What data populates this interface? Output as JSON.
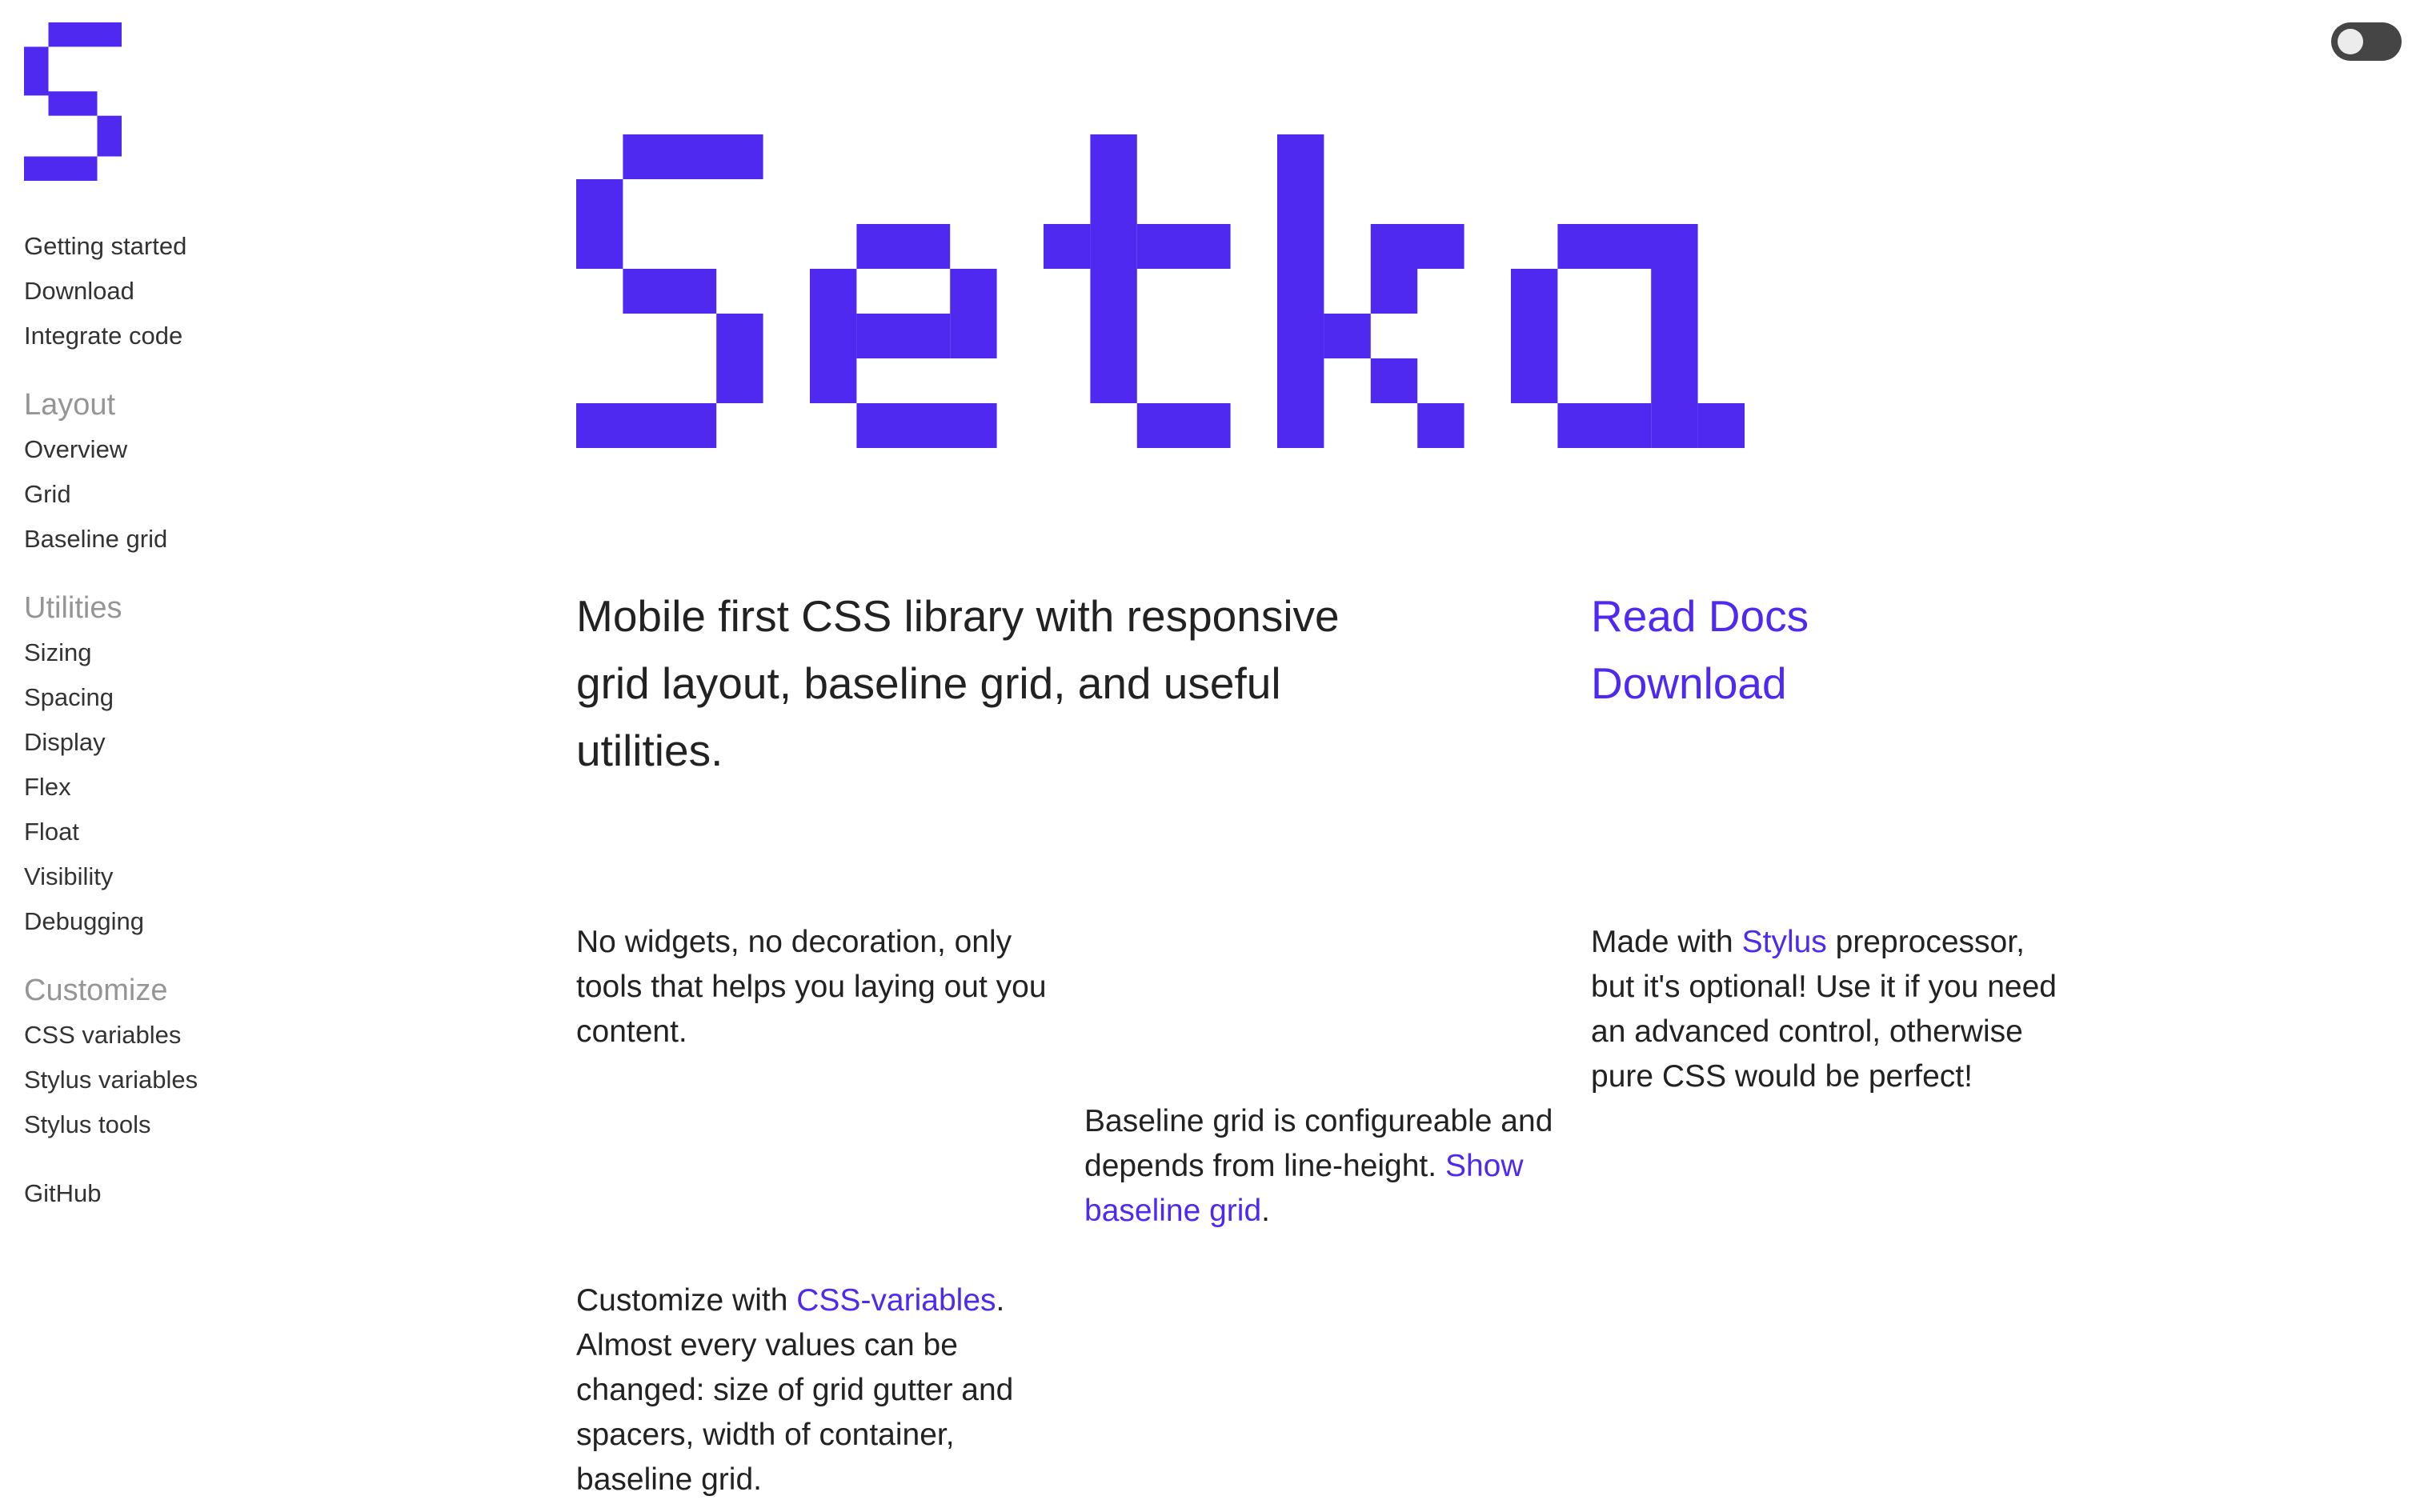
{
  "brand": {
    "logo_icon": "pixel-s-logo",
    "wordmark": "Setko",
    "accent_color": "#4f29f0"
  },
  "theme_toggle": {
    "icon": "toggle-switch-icon",
    "state": "off"
  },
  "sidebar": {
    "intro": [
      "Getting started",
      "Download",
      "Integrate code"
    ],
    "layout": {
      "heading": "Layout",
      "items": [
        "Overview",
        "Grid",
        "Baseline grid"
      ]
    },
    "utilities": {
      "heading": "Utilities",
      "items": [
        "Sizing",
        "Spacing",
        "Display",
        "Flex",
        "Float",
        "Visibility",
        "Debugging"
      ]
    },
    "customize": {
      "heading": "Customize",
      "items": [
        "CSS variables",
        "Stylus variables",
        "Stylus tools"
      ]
    },
    "github": "GitHub"
  },
  "hero": {
    "tagline": "Mobile first CSS library with responsive grid layout, baseline grid, and useful utilities.",
    "read_docs": "Read Docs",
    "download": "Download"
  },
  "features": {
    "widgets": "No widgets, no decoration, only tools that helps you laying out you content.",
    "baseline_text": "Baseline grid is configureable and depends from line-height. ",
    "baseline_link": "Show baseline grid",
    "baseline_end": ".",
    "stylus_pre": "Made with ",
    "stylus_link": "Stylus",
    "stylus_post": " preprocessor, but it's optional! Use it if you need an advanced control, otherwise pure CSS would be perfect!",
    "css_pre": "Customize with ",
    "css_link": "CSS-variables",
    "css_post": ". Almost every values can be changed: size of grid gutter and spacers, width of container, baseline grid."
  }
}
